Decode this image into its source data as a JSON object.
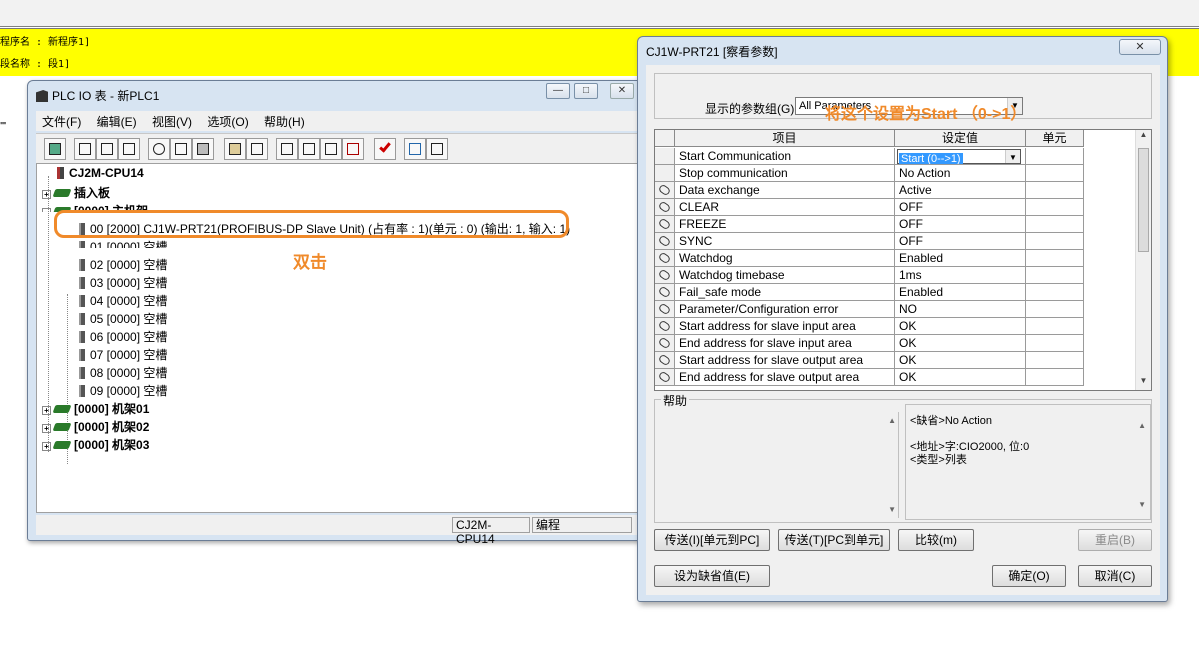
{
  "editor": {
    "line1": "程序名 : 新程序1]",
    "line2": "段名称 : 段1]",
    "dashes": "''''''"
  },
  "plc_window": {
    "title": "PLC IO 表 - 新PLC1",
    "caption_min": "—",
    "caption_max": "□",
    "caption_close": "✕",
    "menu": [
      "文件(F)",
      "编辑(E)",
      "视图(V)",
      "选项(O)",
      "帮助(H)"
    ],
    "toolbar_icons": [
      "ncps-icon",
      "print-icon",
      "print-preview-icon",
      "transfer-icon",
      "cut-icon",
      "copy-icon",
      "paste-icon",
      "unit-config-icon",
      "tool-icon",
      "compare-icon",
      "upload-icon",
      "download-icon",
      "delete-icon",
      "check-icon",
      "online-icon",
      "mail-icon"
    ],
    "tree": {
      "cpu": "CJ2M-CPU14",
      "board": "插入板",
      "main_rack": "[0000] 主机架",
      "slots": [
        "00 [2000] CJ1W-PRT21(PROFIBUS-DP Slave Unit) (占有率 : 1)(单元 : 0) (输出: 1, 输入: 1)",
        "01 [0000] 空槽",
        "02 [0000] 空槽",
        "03 [0000] 空槽",
        "04 [0000] 空槽",
        "05 [0000] 空槽",
        "06 [0000] 空槽",
        "07 [0000] 空槽",
        "08 [0000] 空槽",
        "09 [0000] 空槽"
      ],
      "racks": [
        "[0000] 机架01",
        "[0000] 机架02",
        "[0000] 机架03"
      ]
    },
    "status": {
      "cpu": "CJ2M-CPU14",
      "mode": "编程"
    }
  },
  "annotations": {
    "double_click": "双击",
    "set_start": "将这个设置为Start （0->1）"
  },
  "dialog": {
    "title": "CJ1W-PRT21 [察看参数]",
    "close": "✕",
    "param_group_label": "显示的参数组(G)",
    "param_group_value": "All Parameters",
    "columns": [
      "项目",
      "设定值",
      "单元"
    ],
    "rows": [
      {
        "name": "Start Communication",
        "value": "Start (0-->1)"
      },
      {
        "name": "Stop communication",
        "value": "No Action"
      },
      {
        "name": "Data exchange",
        "value": "Active"
      },
      {
        "name": "CLEAR",
        "value": "OFF"
      },
      {
        "name": "FREEZE",
        "value": "OFF"
      },
      {
        "name": "SYNC",
        "value": "OFF"
      },
      {
        "name": "Watchdog",
        "value": "Enabled"
      },
      {
        "name": "Watchdog timebase",
        "value": "1ms"
      },
      {
        "name": "Fail_safe mode",
        "value": "Enabled"
      },
      {
        "name": "Parameter/Configuration error",
        "value": "NO"
      },
      {
        "name": "Start address for slave input area",
        "value": "OK"
      },
      {
        "name": "End address for slave input area",
        "value": "OK"
      },
      {
        "name": "Start address for slave output area",
        "value": "OK"
      },
      {
        "name": "End address for slave output area",
        "value": "OK"
      }
    ],
    "help_label": "帮助",
    "help_text": {
      "default": "<缺省>No Action",
      "address": "<地址>字:CIO2000, 位:0",
      "type": "<类型>列表"
    },
    "buttons": {
      "transfer_to_pc": "传送(I)[单元到PC]",
      "transfer_to_unit": "传送(T)[PC到单元]",
      "compare": "比较(m)",
      "restart": "重启(B)",
      "set_default": "设为缺省值(E)",
      "ok": "确定(O)",
      "cancel": "取消(C)"
    }
  }
}
